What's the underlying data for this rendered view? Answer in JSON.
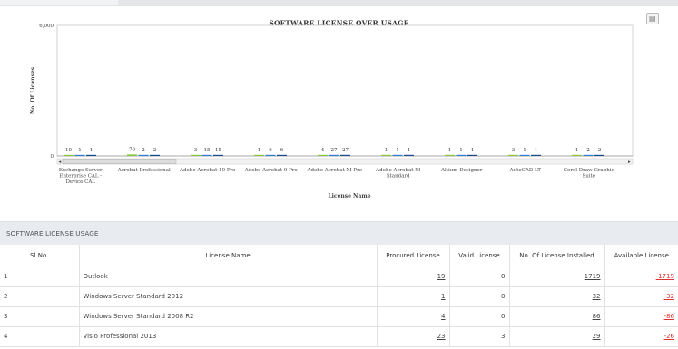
{
  "chart": {
    "title": "SOFTWARE LICENSE OVER USAGE",
    "export_icon": "image-export-icon",
    "y_tick_top": "6,000",
    "y_tick_zero": "0"
  },
  "chart_data": {
    "type": "bar",
    "title": "SOFTWARE LICENSE OVER USAGE",
    "xlabel": "License Name",
    "ylabel": "No. Of Licenses",
    "ylim": [
      0,
      6000
    ],
    "grid": false,
    "categories": [
      "Exchange Server Enterprise CAL - Device CAL",
      "Acrobat Professional",
      "Adobe Acrobat 10 Pro",
      "Adobe Acrobat 9 Pro",
      "Adobe Acrobat XI Pro",
      "Adobe Acrobat XI Standard",
      "Altium Designer",
      "AutoCAD LT",
      "Corel Draw Graphic Suite"
    ],
    "category_lines": [
      [
        "Exchange Server",
        "Enterprise CAL -",
        "Device CAL"
      ],
      [
        "Acrobat Professional"
      ],
      [
        "Adobe Acrobat 10 Pro"
      ],
      [
        "Adobe Acrobat 9 Pro"
      ],
      [
        "Adobe Acrobat XI Pro"
      ],
      [
        "Adobe Acrobat XI",
        "Standard"
      ],
      [
        "Altium Designer"
      ],
      [
        "AutoCAD LT"
      ],
      [
        "Corel Draw Graphic",
        "Suite"
      ]
    ],
    "series": [
      {
        "values": [
          10,
          70,
          3,
          1,
          4,
          1,
          1,
          3,
          1
        ],
        "color": "#8cc63f"
      },
      {
        "values": [
          1,
          2,
          15,
          6,
          27,
          1,
          1,
          1,
          2
        ],
        "color": "#2f7ed8"
      },
      {
        "values": [
          1,
          2,
          15,
          6,
          27,
          1,
          1,
          1,
          2
        ],
        "color": "#1a4b8c"
      }
    ]
  },
  "usage": {
    "title": "SOFTWARE LICENSE USAGE",
    "columns": [
      "Sl No.",
      "License Name",
      "Procured License",
      "Valid License",
      "No. Of License Installed",
      "Available License"
    ],
    "rows": [
      {
        "sl": "1",
        "name": "Outlook",
        "procured": "19",
        "valid": "0",
        "installed": "1719",
        "available": "-1719"
      },
      {
        "sl": "2",
        "name": "Windows Server Standard 2012",
        "procured": "1",
        "valid": "0",
        "installed": "32",
        "available": "-32"
      },
      {
        "sl": "3",
        "name": "Windows Server Standard 2008 R2",
        "procured": "4",
        "valid": "0",
        "installed": "86",
        "available": "-86"
      },
      {
        "sl": "4",
        "name": "Visio Professional 2013",
        "procured": "23",
        "valid": "3",
        "installed": "29",
        "available": "-26"
      }
    ]
  }
}
